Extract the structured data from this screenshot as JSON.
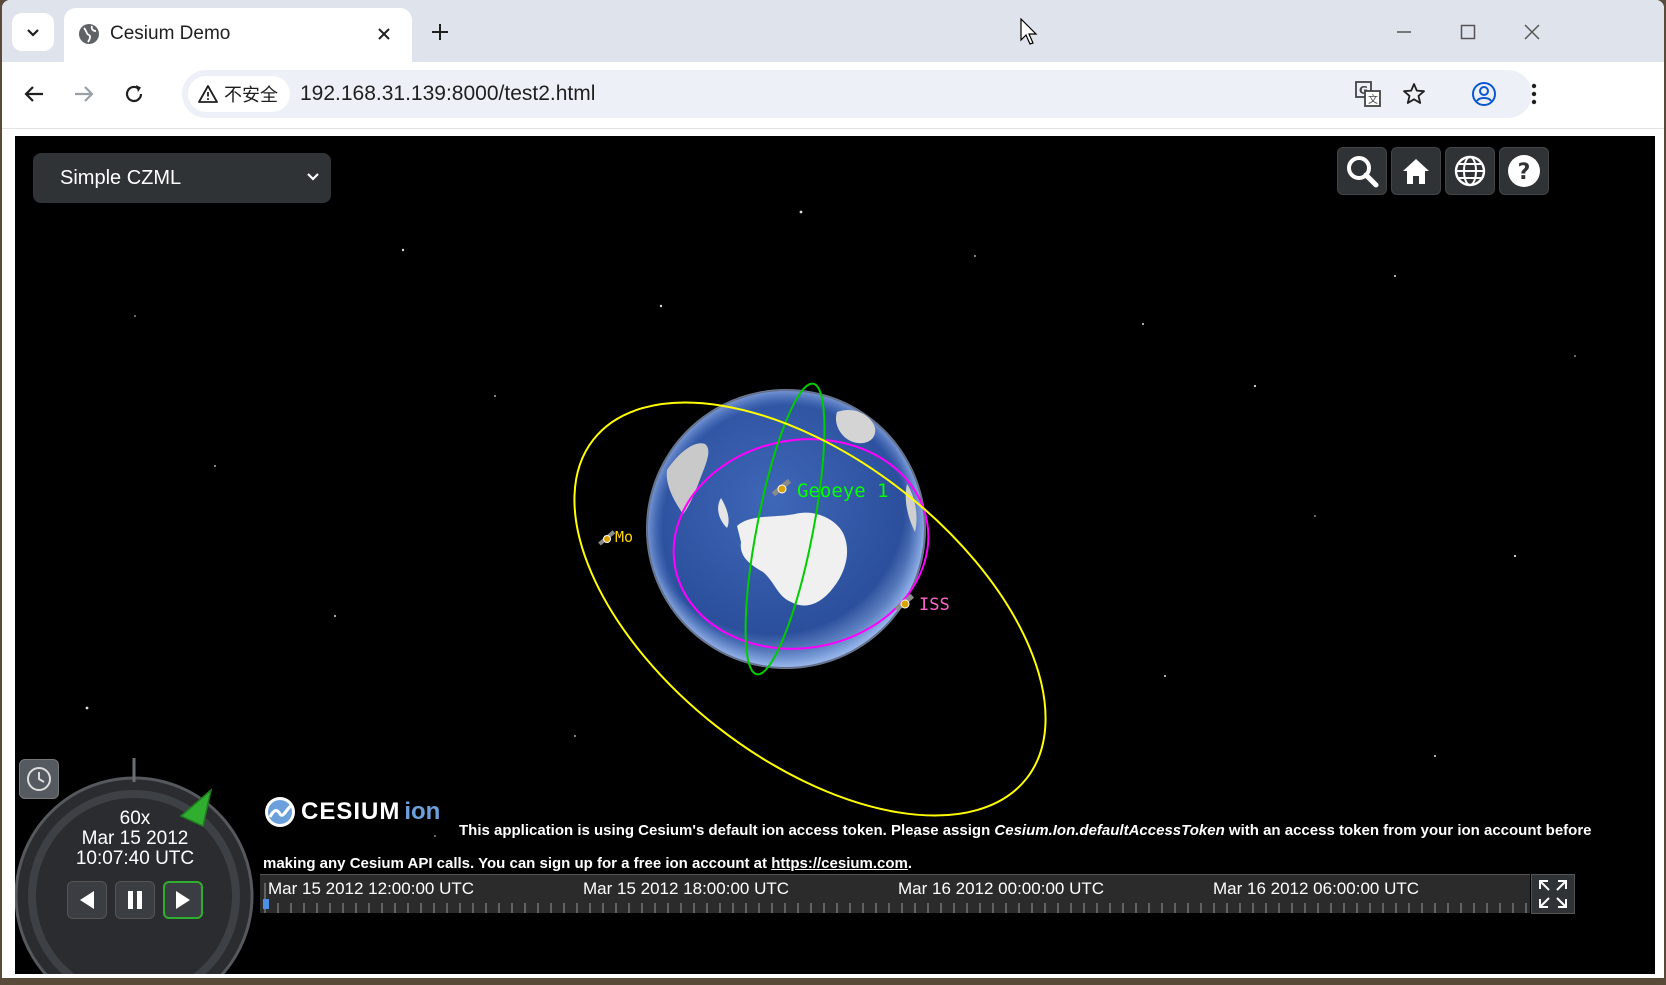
{
  "browser": {
    "tab_title": "Cesium Demo",
    "security_label": "不安全",
    "url": "192.168.31.139:8000/test2.html"
  },
  "cesium": {
    "demo_select": "Simple CZML",
    "satellites": [
      {
        "name": "Geoeye 1",
        "color": "#00ff00"
      },
      {
        "name": "Mo",
        "color": "#ffd700"
      },
      {
        "name": "ISS",
        "color": "#ff66cc"
      }
    ],
    "animation": {
      "speed": "60x",
      "date": "Mar 15 2012",
      "time": "10:07:40 UTC"
    },
    "credit": {
      "logo_text": "CESIUM",
      "logo_suffix": "ion",
      "text_1": "This application is using Cesium's default ion access token. Please assign ",
      "text_italic": "Cesium.Ion.defaultAccessToken",
      "text_2": " with an access token from your ion account before making any Cesium API calls. You can sign up for a free ion account at ",
      "link": "https://cesium.com",
      "text_3": "."
    },
    "timeline": {
      "labels": [
        "Mar 15 2012 12:00:00 UTC",
        "Mar 15 2012 18:00:00 UTC",
        "Mar 16 2012 00:00:00 UTC",
        "Mar 16 2012 06:00:00 UTC"
      ]
    }
  },
  "colors": {
    "orbit_yellow": "#ffff00",
    "orbit_green": "#00cc00",
    "orbit_magenta": "#ff00ff",
    "ocean": "#2b4f9c"
  }
}
